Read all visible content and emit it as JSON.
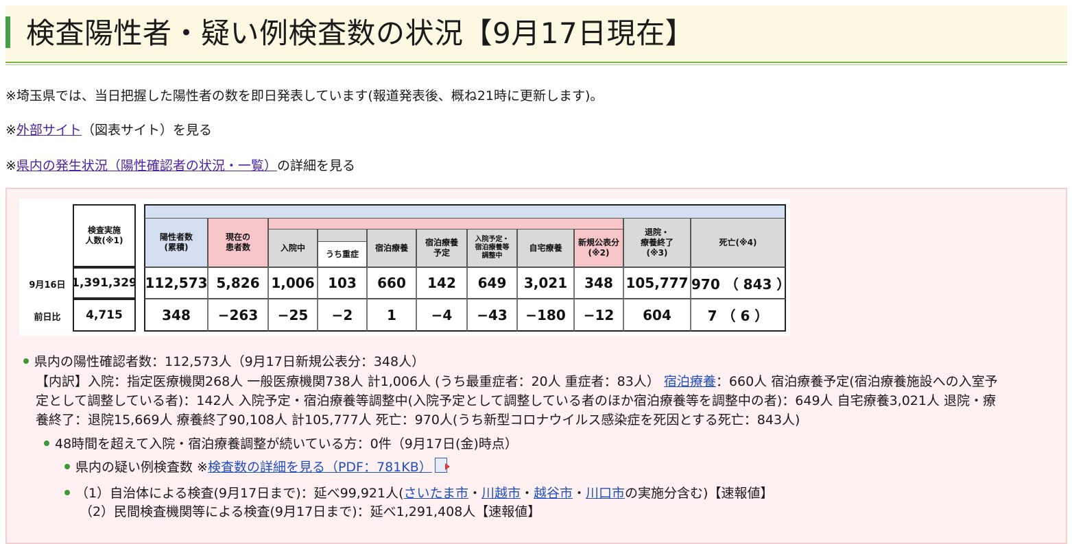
{
  "title": "検査陽性者・疑い例検査数の状況【9月17日現在】",
  "notes": {
    "n1": "※埼玉県では、当日把握した陽性者の数を即日発表しています(報道発表後、概ね21時に更新します)。",
    "n2_prefix": "※",
    "n2_link": "外部サイト",
    "n2_suffix": "（図表サイト）を見る",
    "n3_prefix": "※",
    "n3_link": "県内の発生状況（陽性確認者の状況・一覧）",
    "n3_suffix": "の詳細を見る"
  },
  "table": {
    "headers": {
      "tests": "検査実施\n人数(※1)",
      "positive": "陽性者数\n(累積)",
      "current": "現在の\n患者数",
      "hospital": "入院中",
      "severe": "うち重症",
      "hotel": "宿泊療養",
      "hotel_plan": "宿泊療養\n予定",
      "adjusting": "入院予定・\n宿泊療養等\n調整中",
      "home": "自宅療養",
      "new": "新規公表分\n(※2)",
      "recovered": "退院・\n療養終了\n(※3)",
      "deaths": "死亡(※4)"
    },
    "row1": {
      "label": "9月16日",
      "tests": "1,391,329",
      "positive": "112,573",
      "current": "5,826",
      "hospital": "1,006",
      "severe": "103",
      "hotel": "660",
      "hotel_plan": "142",
      "adjusting": "649",
      "home": "3,021",
      "new": "348",
      "recovered": "105,777",
      "deaths": "970 （ 843 ）"
    },
    "row2": {
      "label": "前日比",
      "tests": "4,715",
      "positive": "348",
      "current": "−263",
      "hospital": "−25",
      "severe": "−2",
      "hotel": "1",
      "hotel_plan": "−4",
      "adjusting": "−43",
      "home": "−180",
      "new": "−12",
      "recovered": "604",
      "deaths": "7 （ 6 ）"
    }
  },
  "summary": {
    "line1": "県内の陽性確認者数：112,573人（9月17日新規公表分：348人）",
    "line2_a": "【内訳】入院：指定医療機関268人 一般医療機関738人 計1,006人 (うち最重症者：20人 重症者：83人）",
    "line2_link": "宿泊療養",
    "line2_b": "：660人 宿泊療養予定(宿泊療養施設への入室予",
    "line3": "定として調整している者)：142人 入院予定・宿泊療養等調整中(入院予定として調整している者のほか宿泊療養等を調整中の者)：649人 自宅療養3,021人 退院・療",
    "line4": "養終了：退院15,669人 療養終了90,108人 計105,777人 死亡：970人(うち新型コロナウイルス感染症を死因とする死亡：843人)"
  },
  "sub1": "48時間を超えて入院・宿泊療養調整が続いている方：0件（9月17日(金)時点）",
  "sub2": {
    "prefix": "県内の疑い例検査数 ※",
    "link": "検査数の詳細を見る（PDF：781KB）"
  },
  "sub3": {
    "prefix": "（1）自治体による検査(9月17日まで)：延べ99,921人(",
    "city1": "さいたま市",
    "sep": "・",
    "city2": "川越市",
    "city3": "越谷市",
    "city4": "川口市",
    "suffix": "の実施分含む)【速報値】",
    "line2": "（2）民間検査機関等による検査(9月17日まで)：延べ1,291,408人【速報値】"
  }
}
